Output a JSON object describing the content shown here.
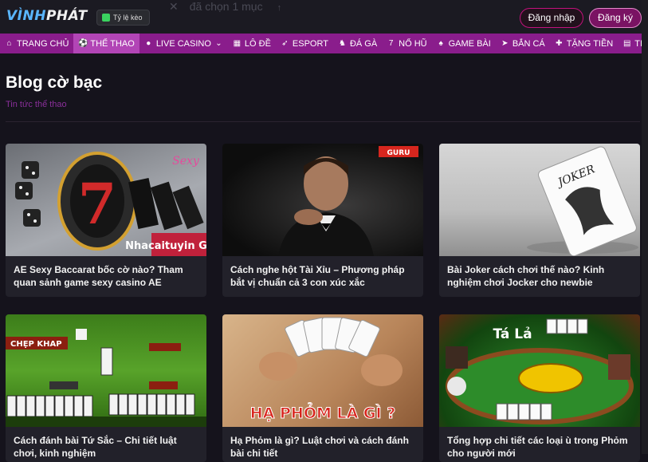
{
  "header": {
    "logo": {
      "part1": "VÌNH",
      "part2": "PHÁT"
    },
    "odds_button": "Tỷ lệ kèo",
    "ghost_text": "đã chọn 1 mục",
    "login_label": "Đăng nhập",
    "register_label": "Đăng ký"
  },
  "nav": {
    "items": [
      {
        "label": "TRANG CHỦ",
        "icon": "home-icon",
        "glyph": "⌂"
      },
      {
        "label": "THỂ THAO",
        "icon": "soccer-ball-icon",
        "glyph": "⚽"
      },
      {
        "label": "LIVE CASINO",
        "icon": "chip-icon",
        "glyph": "●"
      },
      {
        "label": "LÔ ĐỀ",
        "icon": "lottery-icon",
        "glyph": "▦"
      },
      {
        "label": "ESPORT",
        "icon": "rocket-icon",
        "glyph": "➶"
      },
      {
        "label": "ĐÁ GÀ",
        "icon": "rooster-icon",
        "glyph": "♞"
      },
      {
        "label": "NỔ HŨ",
        "icon": "seven-icon",
        "glyph": "7"
      },
      {
        "label": "GAME BÀI",
        "icon": "cards-icon",
        "glyph": "♠"
      },
      {
        "label": "BẮN CÁ",
        "icon": "fish-icon",
        "glyph": "➤"
      },
      {
        "label": "TẶNG TIỀN",
        "icon": "gift-icon",
        "glyph": "✚"
      },
      {
        "label": "TIN TỨC",
        "icon": "news-icon",
        "glyph": "▤"
      }
    ],
    "dropdown_glyph": "⌄"
  },
  "page": {
    "title": "Blog cờ bạc",
    "subtitle": "Tin tức thể thao"
  },
  "posts": [
    {
      "title": "AE Sexy Baccarat bốc cờ nào? Tham quan sảnh game sexy casino AE",
      "badge": "Nhacaituyin GURU"
    },
    {
      "title": "Cách nghe hột Tài Xỉu – Phương pháp bắt vị chuẩn cả 3 con xúc xắc",
      "badge": "GURU"
    },
    {
      "title": "Bài Joker cách chơi thế nào? Kinh nghiệm chơi Jocker cho newbie",
      "badge": "JOKER"
    },
    {
      "title": "Cách đánh bài Tứ Sắc – Chi tiết luật chơi, kinh nghiệm",
      "badge": "CHẸP KHAP"
    },
    {
      "title": "Hạ Phỏm là gì? Luật chơi và cách đánh bài chi tiết",
      "badge": "HẠ PHỎM LÀ GÌ ?"
    },
    {
      "title": "Tổng hợp chi tiết các loại ù trong Phỏm cho người mới",
      "badge": "Tá Lả"
    }
  ]
}
